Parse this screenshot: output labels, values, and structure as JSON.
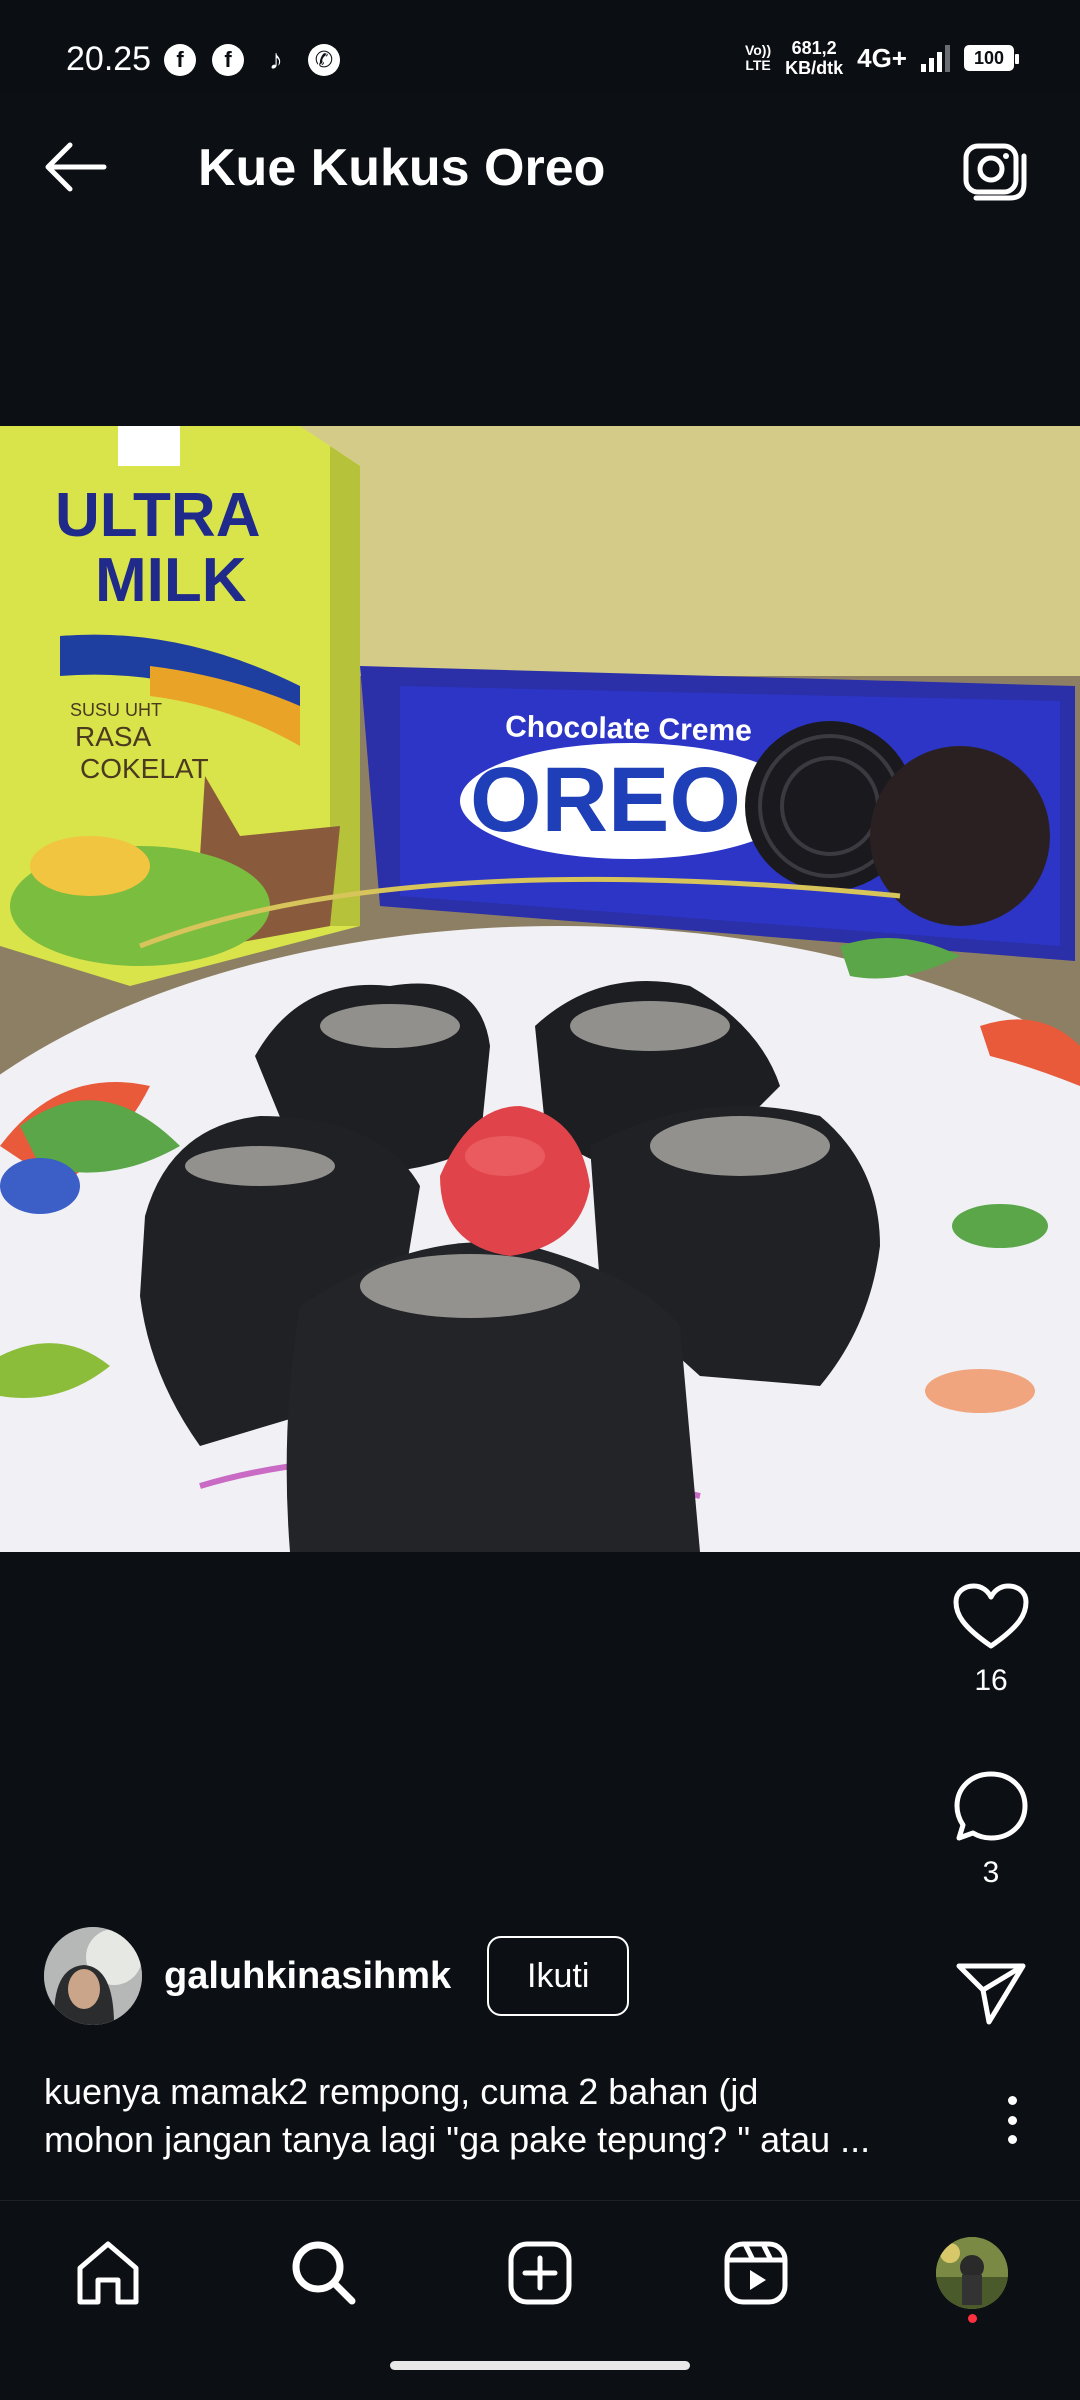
{
  "status": {
    "time": "20.25",
    "volte": [
      "Vo))",
      "LTE"
    ],
    "net_speed": [
      "681,2",
      "KB/dtk"
    ],
    "net_type": "4G+",
    "battery": "100"
  },
  "header": {
    "title": "Kue Kukus Oreo"
  },
  "photo": {
    "milk_brand": [
      "ULTRA",
      "MILK"
    ],
    "milk_flavor": [
      "SUSU UHT",
      "RASA",
      "COKELAT"
    ],
    "oreo_flavor": "Chocolate Creme",
    "oreo_brand": "OREO"
  },
  "actions": {
    "likes": "16",
    "comments": "3"
  },
  "author": {
    "username": "galuhkinasihmk",
    "follow_label": "Ikuti"
  },
  "caption": {
    "line1": "kuenya mamak2 rempong, cuma 2 bahan (jd",
    "line2": "mohon jangan tanya lagi \"ga pake tepung? \" atau ..."
  },
  "colors": {
    "background": "#0c0f14",
    "notification_dot": "#ff3040"
  },
  "icons": [
    "back-arrow-icon",
    "camera-icon",
    "heart-icon",
    "comment-icon",
    "send-icon",
    "more-icon",
    "home-icon",
    "search-icon",
    "create-icon",
    "reels-icon"
  ]
}
